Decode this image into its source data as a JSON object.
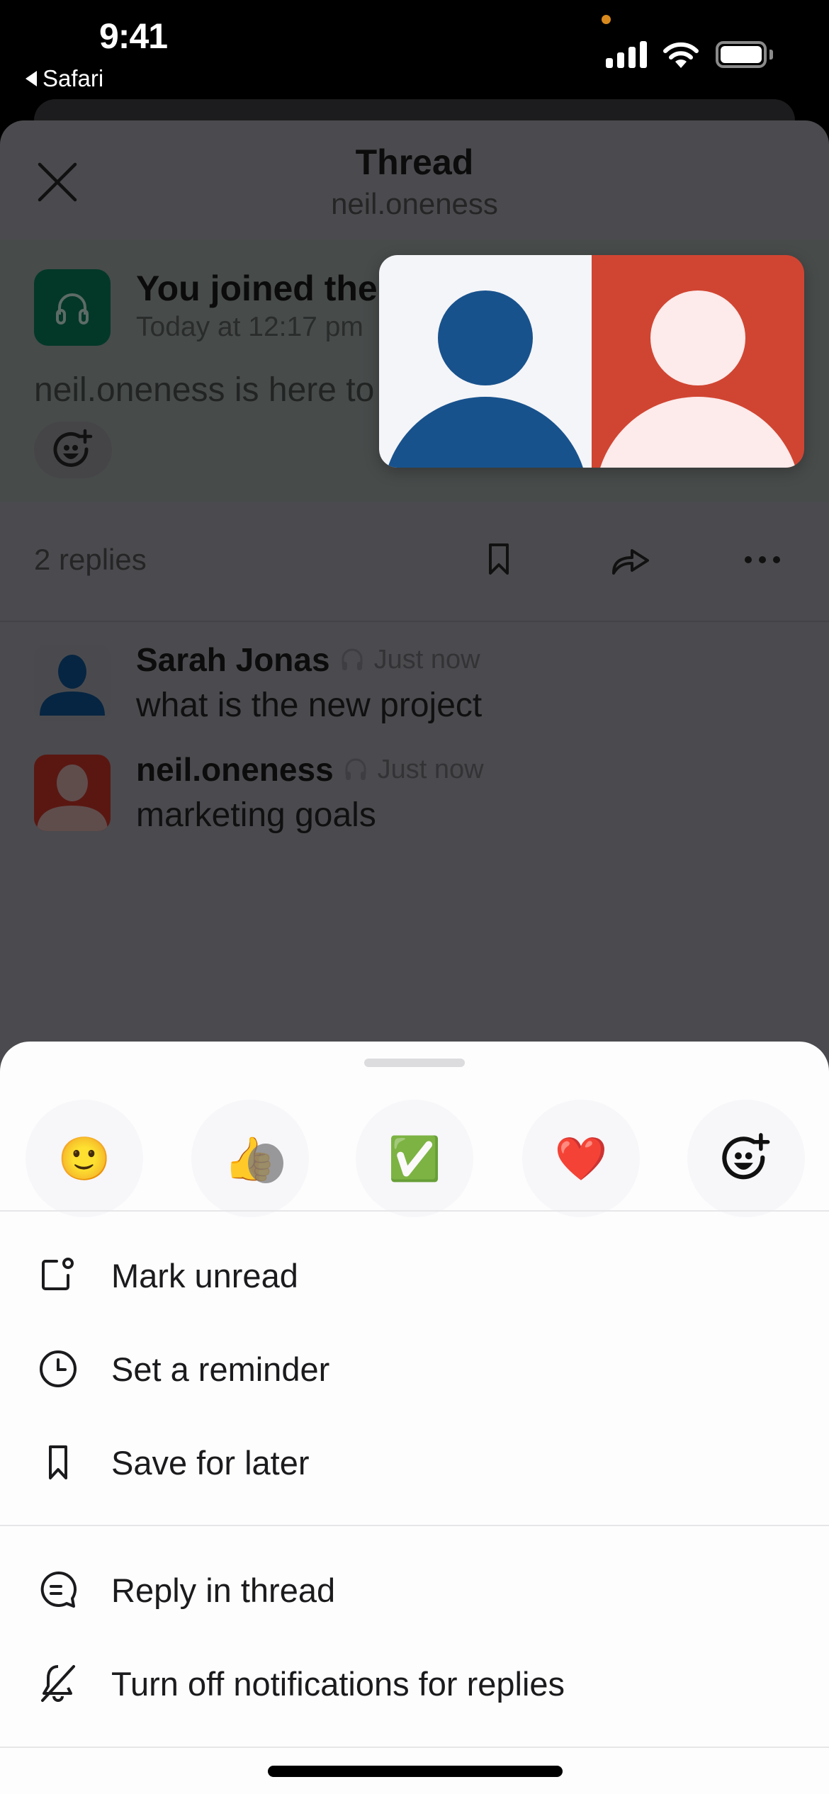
{
  "status_bar": {
    "time": "9:41",
    "back_app": "Safari"
  },
  "header": {
    "title": "Thread",
    "subtitle": "neil.oneness"
  },
  "parent_message": {
    "title": "You joined the",
    "timestamp": "Today at 12:17 pm",
    "text": "neil.oneness is here to"
  },
  "huddle_tiles": [
    {
      "participant": "Sarah Jonas",
      "bg_color": "#f4f5f8",
      "figure_color": "#18528d"
    },
    {
      "participant": "neil.oneness",
      "bg_color": "#d04532",
      "figure_color": "#fdeaea"
    }
  ],
  "thread_bar": {
    "replies_count": "2 replies"
  },
  "replies": [
    {
      "name": "Sarah Jonas",
      "time": "Just now",
      "text": "what is the new project"
    },
    {
      "name": "neil.oneness",
      "time": "Just now",
      "text": "marketing goals"
    }
  ],
  "sheet": {
    "quick_reactions": [
      {
        "name": "slightly-smiling-face",
        "glyph": "🙂"
      },
      {
        "name": "thumbs-up",
        "glyph": "👍"
      },
      {
        "name": "white-check-mark",
        "glyph": "✅"
      },
      {
        "name": "red-heart",
        "glyph": "❤️"
      },
      {
        "name": "add-reaction",
        "glyph": ""
      }
    ],
    "menu_group_1": [
      {
        "label": "Mark unread",
        "icon": "mark-unread-icon"
      },
      {
        "label": "Set a reminder",
        "icon": "clock-icon"
      },
      {
        "label": "Save for later",
        "icon": "bookmark-icon"
      }
    ],
    "menu_group_2": [
      {
        "label": "Reply in thread",
        "icon": "reply-thread-icon"
      },
      {
        "label": "Turn off notifications for replies",
        "icon": "bell-off-icon"
      }
    ]
  }
}
